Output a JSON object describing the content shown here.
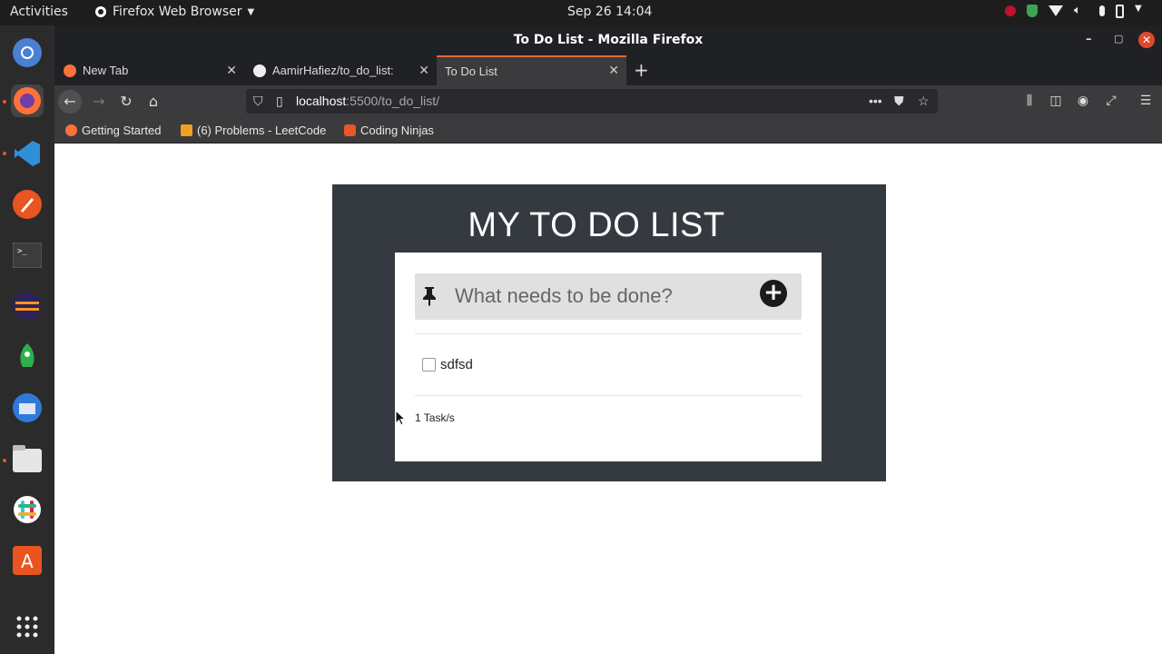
{
  "system": {
    "activities": "Activities",
    "app_menu": "Firefox Web Browser",
    "clock": "Sep 26  14:04"
  },
  "window": {
    "title": "To Do List - Mozilla Firefox"
  },
  "tabs": [
    {
      "label": "New Tab"
    },
    {
      "label": "AamirHafiez/to_do_list:"
    },
    {
      "label": "To Do List"
    }
  ],
  "url": {
    "host": "localhost",
    "path": ":5500/to_do_list/"
  },
  "bookmarks": [
    {
      "label": "Getting Started"
    },
    {
      "label": "(6) Problems - LeetCode"
    },
    {
      "label": "Coding Ninjas"
    }
  ],
  "app": {
    "title": "MY TO DO LIST",
    "input_placeholder": "What needs to be done?",
    "tasks": [
      {
        "text": "sdfsd",
        "done": false
      }
    ],
    "count_label": "1 Task/s"
  },
  "colors": {
    "card_bg": "#343a40",
    "input_bg": "#e0e0e0",
    "tab_accent": "#e66a34"
  }
}
